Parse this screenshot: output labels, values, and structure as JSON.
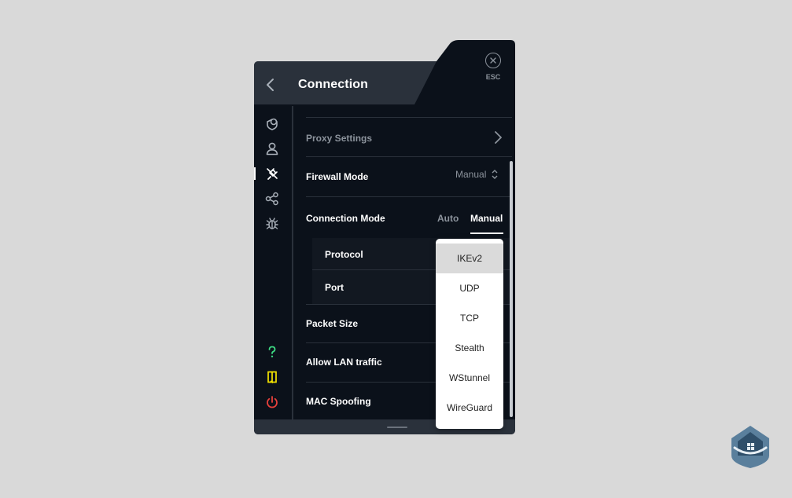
{
  "header": {
    "title": "Connection",
    "esc_label": "ESC"
  },
  "sidebar": {
    "items": [
      {
        "name": "locations",
        "icon": "shield-stack-icon",
        "color": "#a9b0b9"
      },
      {
        "name": "account",
        "icon": "user-icon",
        "color": "#a9b0b9"
      },
      {
        "name": "connection",
        "icon": "plug-icon",
        "color": "#ffffff",
        "active": true
      },
      {
        "name": "share",
        "icon": "share-icon",
        "color": "#a9b0b9"
      },
      {
        "name": "debug",
        "icon": "bug-icon",
        "color": "#a9b0b9"
      }
    ],
    "bottom": [
      {
        "name": "help",
        "icon": "question-icon",
        "color": "#3ddc84"
      },
      {
        "name": "news",
        "icon": "book-icon",
        "color": "#f5e400"
      },
      {
        "name": "quit",
        "icon": "power-icon",
        "color": "#e8413c"
      }
    ]
  },
  "settings": {
    "proxy_settings": "Proxy Settings",
    "firewall_mode": {
      "label": "Firewall Mode",
      "value": "Manual"
    },
    "connection_mode": {
      "label": "Connection Mode",
      "options": [
        "Auto",
        "Manual"
      ],
      "selected": "Manual"
    },
    "protocol": {
      "label": "Protocol"
    },
    "port": {
      "label": "Port"
    },
    "packet_size": {
      "label": "Packet Size"
    },
    "allow_lan": {
      "label": "Allow LAN traffic"
    },
    "mac_spoofing": {
      "label": "MAC Spoofing"
    }
  },
  "protocol_dropdown": {
    "options": [
      "IKEv2",
      "UDP",
      "TCP",
      "Stealth",
      "WStunnel",
      "WireGuard"
    ],
    "selected": "IKEv2"
  },
  "colors": {
    "panel": "#0b111a",
    "header": "#2a313b",
    "accent_help": "#3ddc84",
    "accent_news": "#f5e400",
    "accent_quit": "#e8413c",
    "badge": "#5a7f9c"
  }
}
